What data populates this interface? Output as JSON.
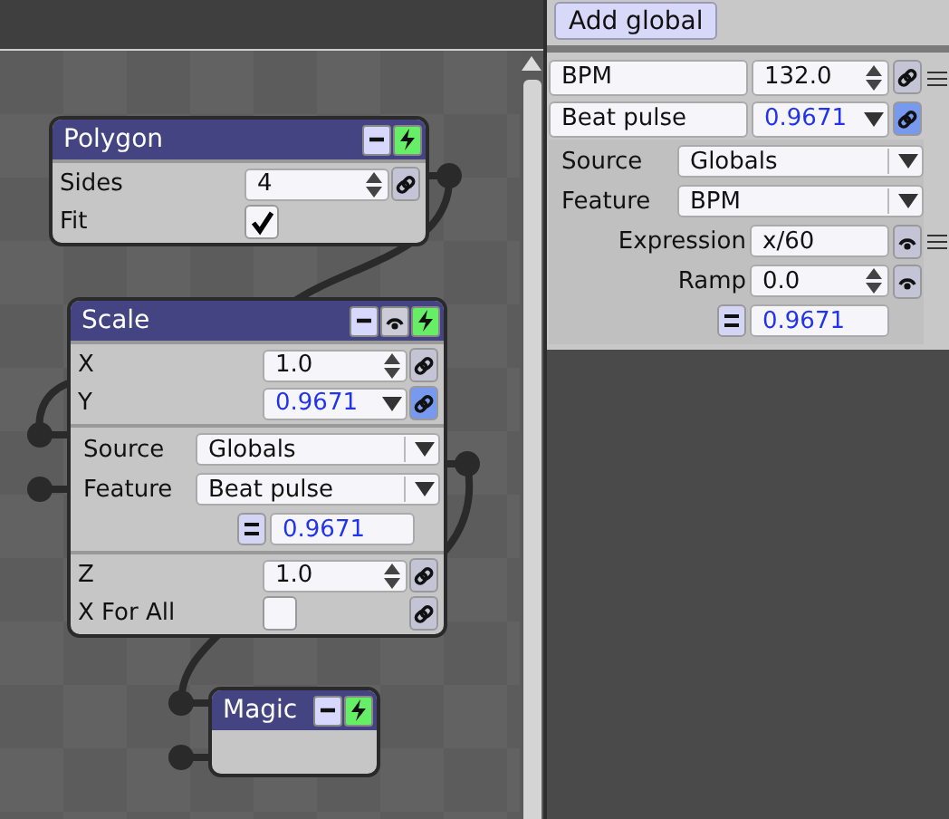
{
  "canvas": {
    "nodes": [
      {
        "title": "Polygon",
        "header_buttons": [
          {
            "kind": "collapse"
          },
          {
            "kind": "enable",
            "on": true
          }
        ],
        "sections": [
          [
            {
              "label": "Sides",
              "kind": "spin",
              "value": "4",
              "linked": false
            },
            {
              "label": "Fit",
              "kind": "check",
              "checked": true
            }
          ]
        ]
      },
      {
        "title": "Scale",
        "header_buttons": [
          {
            "kind": "collapse"
          },
          {
            "kind": "watch"
          },
          {
            "kind": "enable",
            "on": true
          }
        ],
        "sections": [
          [
            {
              "label": "X",
              "kind": "spin",
              "value": "1.0",
              "linked": false
            },
            {
              "label": "Y",
              "kind": "driven",
              "value": "0.9671",
              "linked": true
            }
          ],
          [
            {
              "label": "Source",
              "kind": "dropdown",
              "value": "Globals"
            },
            {
              "label": "Feature",
              "kind": "dropdown",
              "value": "Beat pulse"
            },
            {
              "kind": "output",
              "value": "0.9671"
            }
          ],
          [
            {
              "label": "Z",
              "kind": "spin",
              "value": "1.0",
              "linked": false
            },
            {
              "label": "X For All",
              "kind": "check",
              "checked": false,
              "linked": false
            }
          ]
        ]
      },
      {
        "title": "Magic",
        "header_buttons": [
          {
            "kind": "collapse"
          },
          {
            "kind": "enable",
            "on": true
          }
        ]
      }
    ]
  },
  "panel": {
    "add_button": "Add global",
    "globals": [
      {
        "name": "BPM",
        "kind": "spin",
        "value": "132.0",
        "linked": false
      },
      {
        "name": "Beat pulse",
        "kind": "driven",
        "value": "0.9671",
        "linked": true,
        "settings": [
          {
            "kind": "dropdown",
            "label": "Source",
            "value": "Globals"
          },
          {
            "kind": "dropdown",
            "label": "Feature",
            "value": "BPM"
          },
          {
            "kind": "text",
            "label": "Expression",
            "value": "x/60"
          },
          {
            "kind": "spin",
            "label": "Ramp",
            "value": "0.0"
          },
          {
            "kind": "output",
            "value": "0.9671"
          }
        ]
      }
    ]
  }
}
